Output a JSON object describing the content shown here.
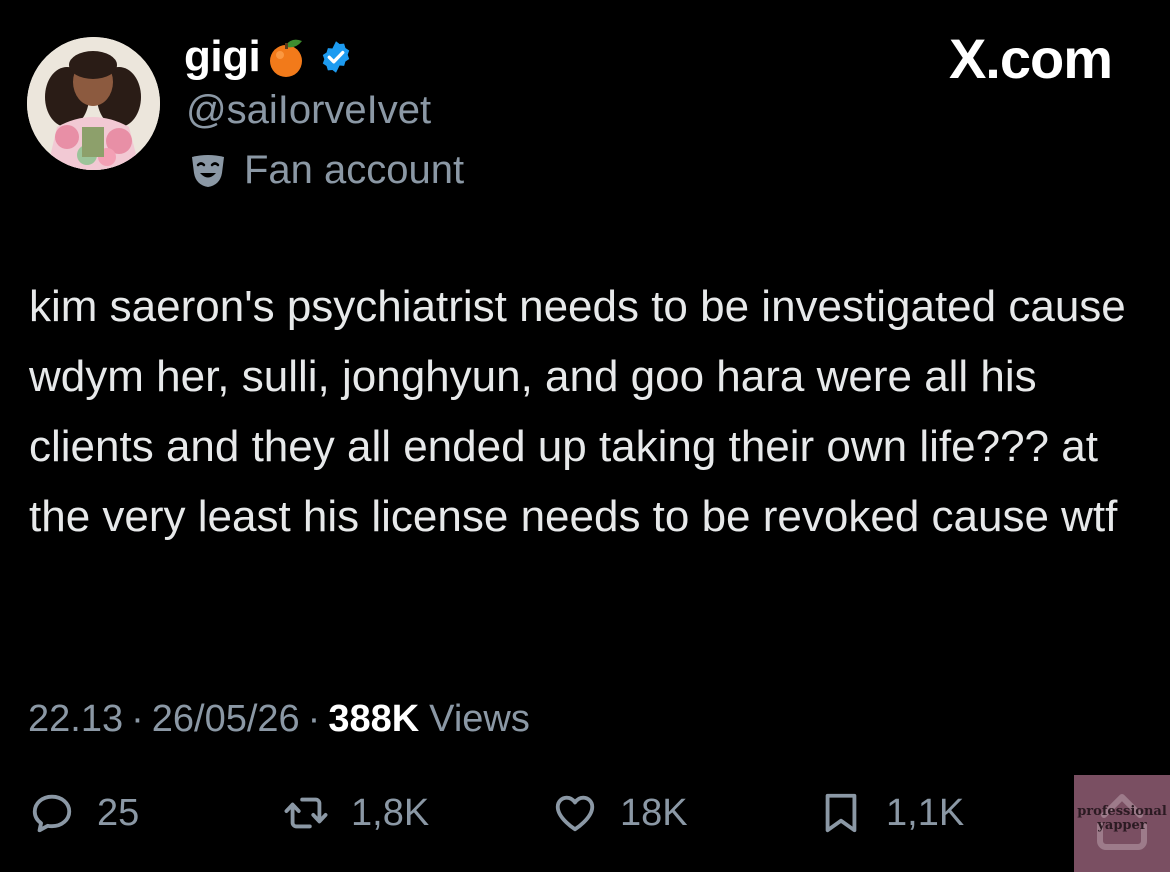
{
  "profile": {
    "display_name": "gigi",
    "emoji_icon": "tangerine-icon",
    "verified_icon": "verified-badge-icon",
    "handle": "@saiIorveIvet",
    "label_icon": "theater-mask-icon",
    "label_text": "Fan account"
  },
  "brand": {
    "site": "X.com"
  },
  "tweet": {
    "text": "kim saeron's psychiatrist needs to be investigated cause wdym her, sulli, jonghyun, and goo hara were all his clients and they all ended up taking their own life??? at the very least his license needs to be revoked cause wtf",
    "time": "22.13",
    "date": "26/05/26",
    "views_count": "388K",
    "views_label": "Views",
    "separator": "·"
  },
  "actions": {
    "replies": {
      "icon": "reply-icon",
      "count": "25"
    },
    "reposts": {
      "icon": "repost-icon",
      "count": "1,8K"
    },
    "likes": {
      "icon": "heart-icon",
      "count": "18K"
    },
    "bookmarks": {
      "icon": "bookmark-icon",
      "count": "1,1K"
    }
  },
  "watermark": {
    "line1": "professional",
    "line2": "yapper"
  },
  "colors": {
    "background": "#000000",
    "text": "#e7e9ea",
    "muted": "#8b98a5",
    "verified": "#1d9bf0",
    "watermark_bg": "#7a4f62"
  }
}
